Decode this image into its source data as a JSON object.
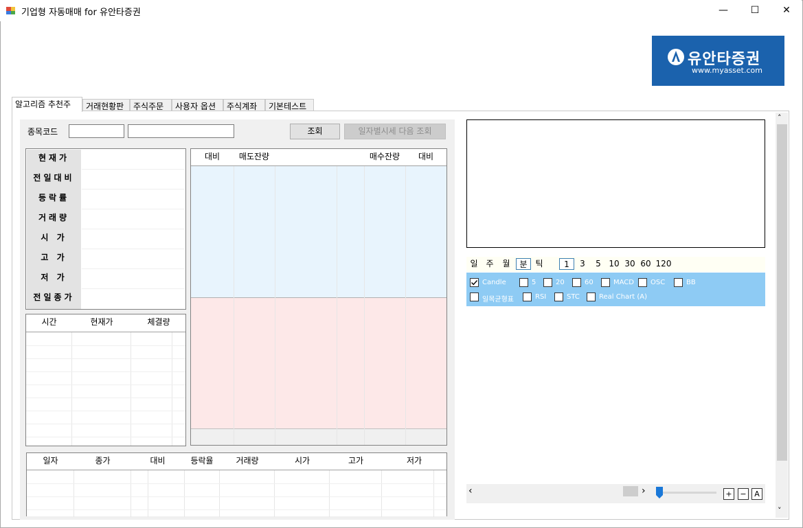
{
  "window": {
    "title": "기업형 자동매매 for  유안타증권",
    "minimize": "—",
    "maximize": "☐",
    "close": "✕"
  },
  "logo": {
    "brand": "유안타증권",
    "url": "www.myasset.com",
    "color": "#1b62ad"
  },
  "tabs": [
    "알고리즘 추천주",
    "거래현황판",
    "주식주문",
    "사용자 옵션",
    "주식계좌",
    "기본테스트"
  ],
  "search": {
    "label": "종목코드",
    "code_value": "",
    "name_value": "",
    "query_button": "조회",
    "next_button": "일자별시세 다음 조회"
  },
  "quote_rows": [
    "현재가",
    "전일대비",
    "등락률",
    "거래량",
    "시    가",
    "고    가",
    "저    가",
    "전일종가"
  ],
  "orderbook_headers": [
    "대비",
    "매도잔량",
    "",
    "매수잔량",
    "대비"
  ],
  "ticks_headers": [
    "시간",
    "현재가",
    "체결량"
  ],
  "daily_headers": [
    "일자",
    "종가",
    "대비",
    "등락율",
    "거래량",
    "시가",
    "고가",
    "저가"
  ],
  "period_buttons": [
    "일",
    "주",
    "월",
    "분",
    "틱"
  ],
  "selected_period": "분",
  "interval_buttons": [
    "1",
    "3",
    "5",
    "10",
    "30",
    "60",
    "120"
  ],
  "selected_interval": "1",
  "indicators_row1": [
    {
      "label": "Candle",
      "checked": true
    },
    {
      "label": "5",
      "checked": false
    },
    {
      "label": "20",
      "checked": false
    },
    {
      "label": "60",
      "checked": false
    },
    {
      "label": "MACD",
      "checked": false
    },
    {
      "label": "OSC",
      "checked": false
    },
    {
      "label": "BB",
      "checked": false
    }
  ],
  "indicators_row2": [
    {
      "label": "일목균형표",
      "checked": false
    },
    {
      "label": "RSI",
      "checked": false
    },
    {
      "label": "STC",
      "checked": false
    },
    {
      "label": "Real Chart (A)",
      "checked": false
    }
  ],
  "zoom": {
    "plus": "+",
    "minus": "−",
    "auto": "A"
  },
  "scroll": {
    "left": "‹",
    "right": "›",
    "up": "˄",
    "down": "˅"
  },
  "colors": {
    "ask_bg": "#e8f4fd",
    "bid_bg": "#fde8e8",
    "indicator_bg": "#8ecbf4",
    "period_bg": "#fffff4"
  }
}
